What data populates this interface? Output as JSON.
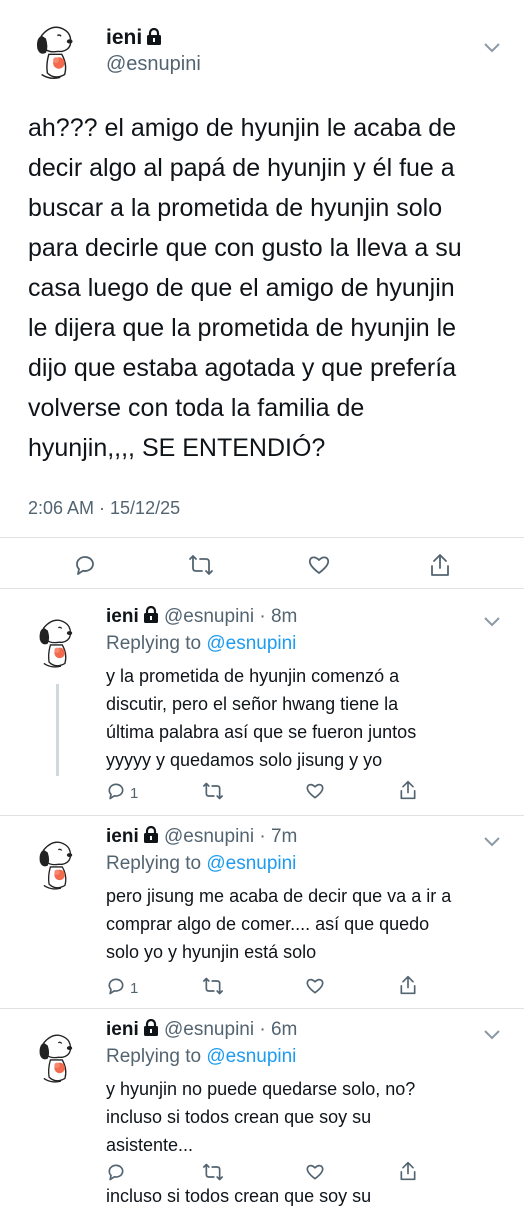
{
  "main_tweet": {
    "name": "ieni",
    "handle": "@esnupini",
    "text_lines": [
      "ah??? el amigo de hyunjin le acaba de",
      "decir algo al papá de hyunjin y él fue a",
      "buscar a la prometida de hyunjin solo",
      "para decirle que con gusto la lleva a su",
      "casa luego de que el amigo de hyunjin",
      "le dijera que la prometida de hyunjin le",
      "dijo que estaba agotada y que prefería",
      "volverse con toda la familia de",
      "hyunjin,,,, SE ENTENDIÓ?"
    ],
    "timestamp": "2:06 AM · 15/12/25"
  },
  "replies": [
    {
      "name": "ieni",
      "handle_time": "@esnupini · 8m",
      "replying_prefix": "Replying to ",
      "replying_to": "@esnupini",
      "text_lines": [
        "y la prometida de hyunjin comenzó a",
        "discutir, pero el señor hwang tiene la",
        "última palabra así que se fueron juntos",
        "yyyyy y quedamos solo jisung y yo"
      ],
      "reply_count": "1"
    },
    {
      "name": "ieni",
      "handle_time": "@esnupini · 7m",
      "replying_prefix": "Replying to ",
      "replying_to": "@esnupini",
      "text_lines": [
        "pero jisung me acaba de decir que va a ir a",
        "comprar algo de comer.... así que quedo",
        "solo yo y hyunjin está solo"
      ],
      "reply_count": "1"
    },
    {
      "name": "ieni",
      "handle_time": "@esnupini · 6m",
      "replying_prefix": "Replying to ",
      "replying_to": "@esnupini",
      "text_lines": [
        "y hyunjin no puede quedarse solo, no?",
        "incluso si todos crean que soy su",
        "asistente..."
      ]
    }
  ],
  "cutoff_text": "incluso si todos crean que soy su",
  "colors": {
    "text": "#0f1419",
    "secondary": "#536471",
    "link": "#1d9bf0",
    "divider": "#dfe3e6"
  },
  "icons": [
    "lock-icon",
    "chevron-down-icon",
    "reply-icon",
    "retweet-icon",
    "like-icon",
    "share-icon"
  ]
}
